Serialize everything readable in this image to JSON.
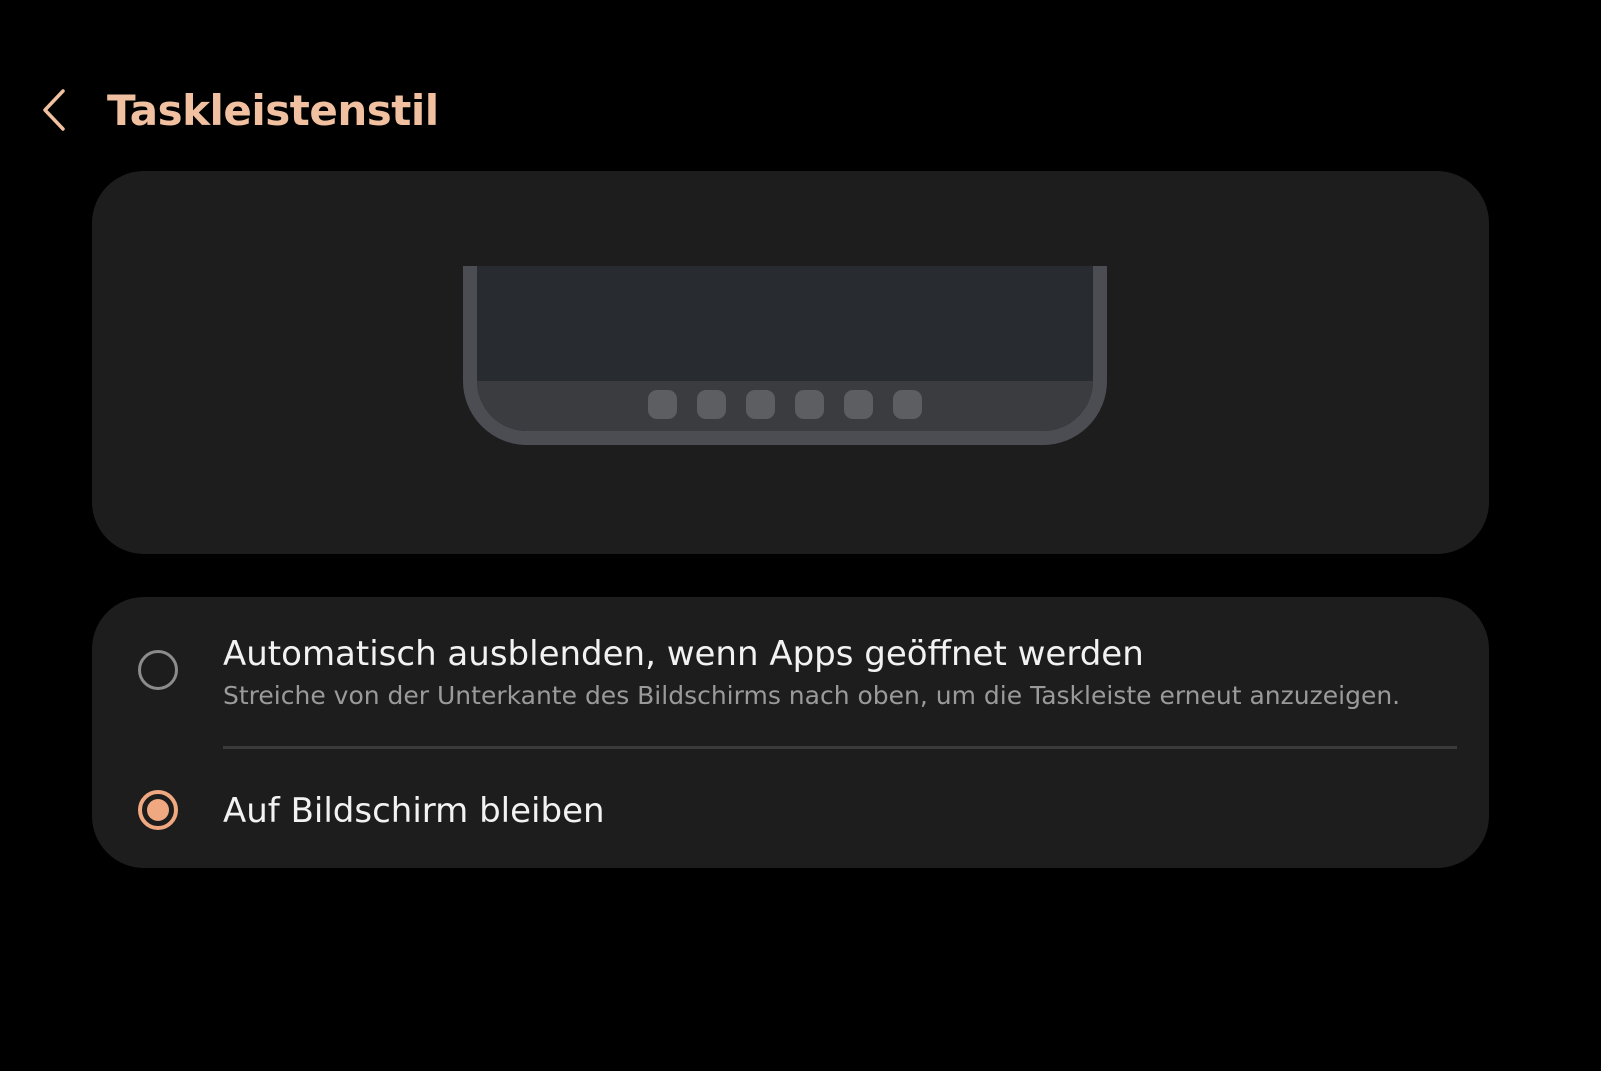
{
  "header": {
    "title": "Taskleistenstil",
    "back_icon": "chevron-left-icon",
    "accent_color": "#f0c0a0"
  },
  "preview": {
    "description_icon": "taskbar-preview-illustration",
    "dock_icon_count": 6
  },
  "options": [
    {
      "title": "Automatisch ausblenden, wenn Apps geöffnet werden",
      "subtitle": "Streiche von der Unterkante des Bildschirms nach oben, um die Taskleiste erneut anzuzeigen.",
      "selected": false
    },
    {
      "title": "Auf Bildschirm bleiben",
      "selected": true
    }
  ],
  "colors": {
    "background": "#000000",
    "card": "#1d1d1d",
    "radio_selected": "#f0a880",
    "radio_unselected": "#8c8c8c",
    "primary_text": "#f2f2f2",
    "secondary_text": "#9a9a9a"
  }
}
